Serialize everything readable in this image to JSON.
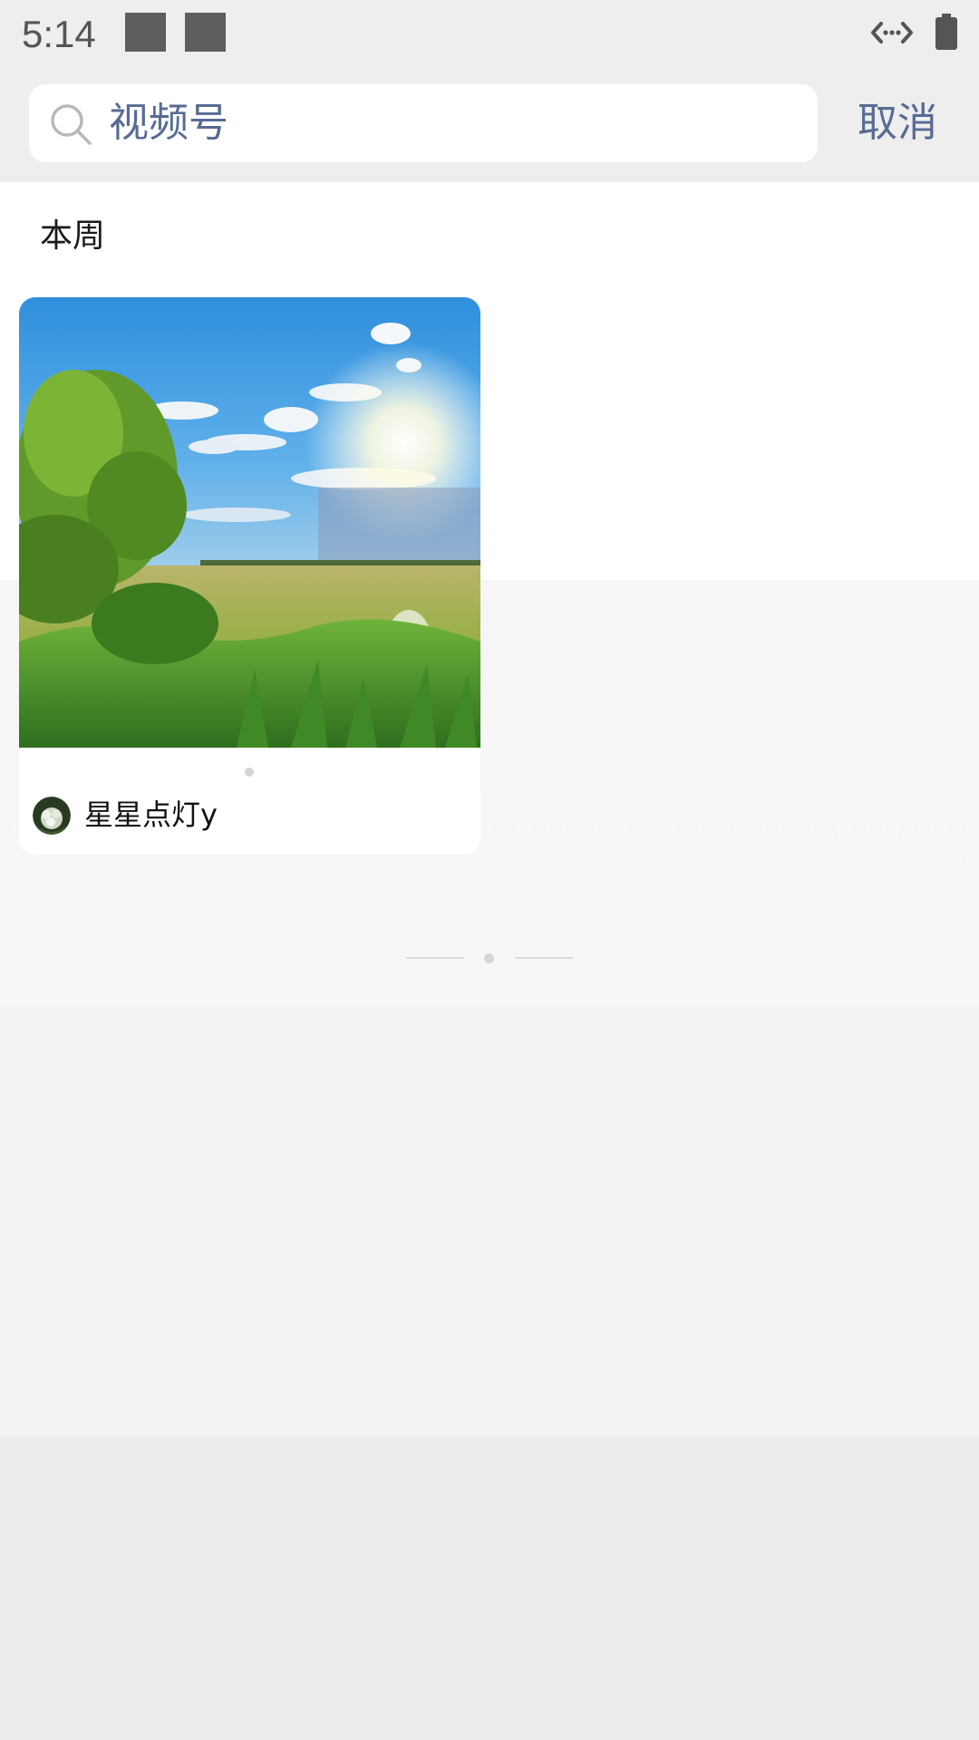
{
  "status_bar": {
    "time": "5:14"
  },
  "search": {
    "query": "视频号",
    "cancel_label": "取消"
  },
  "section": {
    "label": "本周"
  },
  "results": [
    {
      "author": "星星点灯y",
      "thumbnail": "sunny-meadow-landscape"
    }
  ],
  "icons": {
    "search": "search-icon",
    "data": "data-transfer-icon",
    "battery": "battery-icon"
  },
  "colors": {
    "link_blue": "#576b95",
    "header_gray": "#eeeeee"
  }
}
